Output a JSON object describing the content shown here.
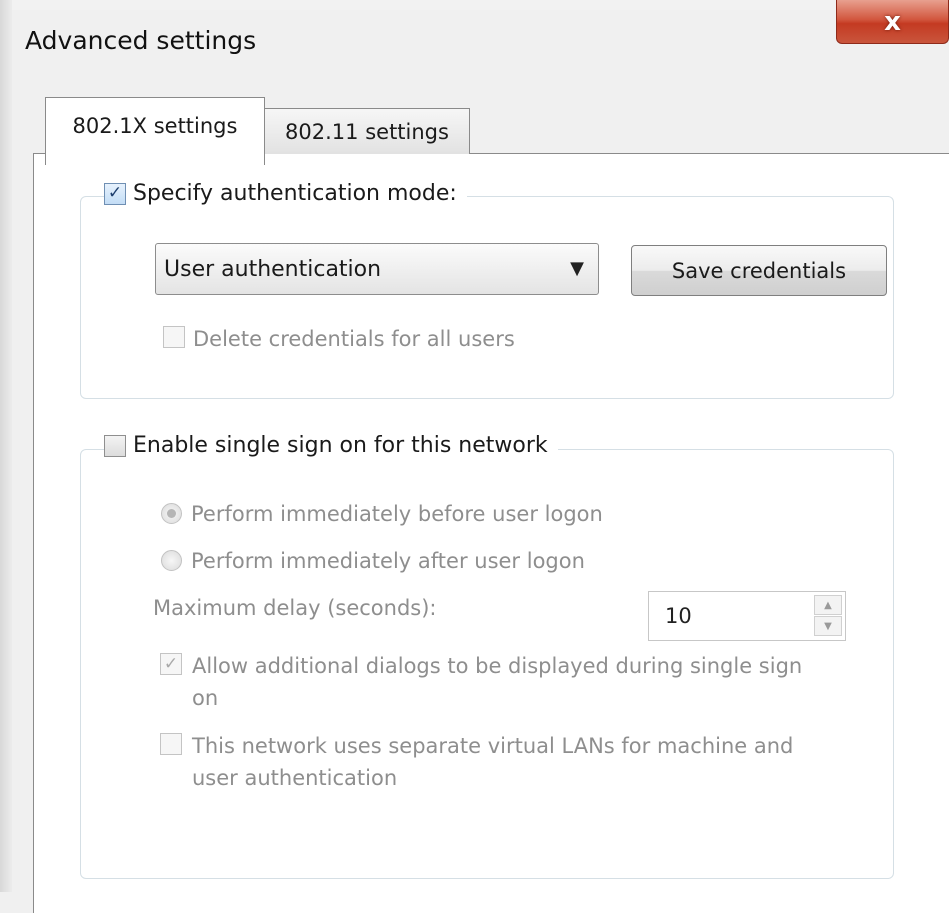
{
  "window": {
    "title": "Advanced settings",
    "close_glyph": "x"
  },
  "tabs": [
    {
      "label": "802.1X settings",
      "selected": true
    },
    {
      "label": "802.11 settings",
      "selected": false
    }
  ],
  "auth_group": {
    "legend_label": "Specify authentication mode:",
    "checked": true,
    "mode_select": {
      "value": "User authentication",
      "arrow_icon": "chevron-down-icon"
    },
    "save_credentials_label": "Save credentials",
    "delete_credentials_label": "Delete credentials for all users",
    "delete_credentials_checked": false
  },
  "sso_group": {
    "legend_label": "Enable single sign on for this network",
    "checked": false,
    "radio_options": [
      {
        "label": "Perform immediately before user logon",
        "selected": true
      },
      {
        "label": "Perform immediately after user logon",
        "selected": false
      }
    ],
    "max_delay_label": "Maximum delay (seconds):",
    "max_delay_value": "10",
    "allow_dialogs_label": "Allow additional dialogs to be displayed during single sign on",
    "allow_dialogs_checked": true,
    "vlan_label": "This network uses separate virtual LANs for machine and user authentication",
    "vlan_checked": false
  },
  "colors": {
    "close_button": "#c43a22",
    "checkbox_tick": "#1e3f6e",
    "disabled_text": "#8e8e8e"
  }
}
